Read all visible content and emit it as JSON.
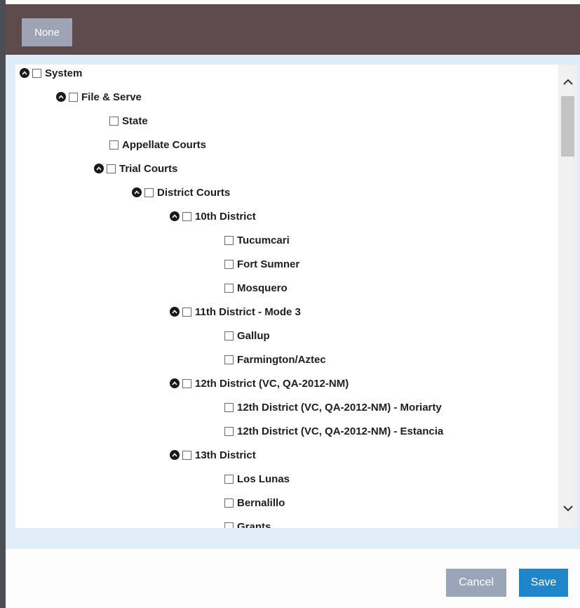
{
  "colors": {
    "header_bg": "#5e4a4a",
    "body_band": "#dfedf6",
    "save_button": "#1f87c9",
    "cancel_button": "#98a6b8",
    "none_button": "#9ea3b6"
  },
  "header": {
    "none_label": "None"
  },
  "tree": {
    "expander_icon": "chevron-up-circle-icon",
    "items": [
      {
        "label": "System",
        "level": 0,
        "expandable": true
      },
      {
        "label": "File & Serve",
        "level": 1,
        "expandable": true
      },
      {
        "label": "State",
        "level": 2,
        "expandable": false
      },
      {
        "label": "Appellate Courts",
        "level": 2,
        "expandable": false
      },
      {
        "label": "Trial Courts",
        "level": 2,
        "expandable": true
      },
      {
        "label": "District Courts",
        "level": 3,
        "expandable": true
      },
      {
        "label": "10th District",
        "level": 4,
        "expandable": true
      },
      {
        "label": "Tucumcari",
        "level": 5,
        "expandable": false
      },
      {
        "label": "Fort Sumner",
        "level": 5,
        "expandable": false
      },
      {
        "label": "Mosquero",
        "level": 5,
        "expandable": false
      },
      {
        "label": "11th District - Mode 3",
        "level": 4,
        "expandable": true
      },
      {
        "label": "Gallup",
        "level": 5,
        "expandable": false
      },
      {
        "label": "Farmington/Aztec",
        "level": 5,
        "expandable": false
      },
      {
        "label": "12th District (VC, QA-2012-NM)",
        "level": 4,
        "expandable": true
      },
      {
        "label": "12th District (VC, QA-2012-NM) - Moriarty",
        "level": 5,
        "expandable": false
      },
      {
        "label": "12th District (VC, QA-2012-NM) - Estancia",
        "level": 5,
        "expandable": false
      },
      {
        "label": "13th District",
        "level": 4,
        "expandable": true
      },
      {
        "label": "Los Lunas",
        "level": 5,
        "expandable": false
      },
      {
        "label": "Bernalillo",
        "level": 5,
        "expandable": false
      },
      {
        "label": "Grants",
        "level": 5,
        "expandable": false
      }
    ]
  },
  "footer": {
    "cancel_label": "Cancel",
    "save_label": "Save"
  }
}
